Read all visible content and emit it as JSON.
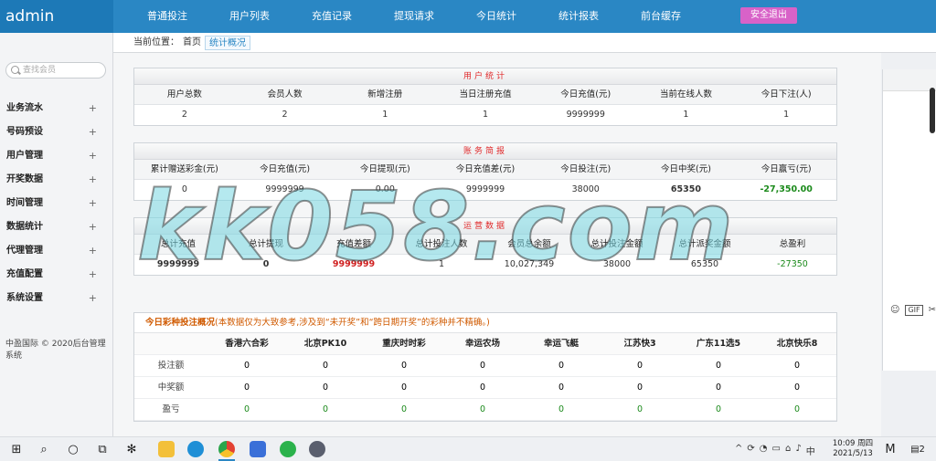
{
  "header": {
    "logo": "admin",
    "nav": [
      "普通投注",
      "用户列表",
      "充值记录",
      "提现请求",
      "今日统计",
      "统计报表",
      "前台缓存"
    ],
    "logout": "安全退出"
  },
  "breadcrumb": {
    "label": "当前位置：",
    "home": "首页",
    "current": "统计概况"
  },
  "sidebar": {
    "search_placeholder": "查找会员",
    "items": [
      {
        "label": "业务流水"
      },
      {
        "label": "号码预设"
      },
      {
        "label": "用户管理"
      },
      {
        "label": "开奖数据"
      },
      {
        "label": "时间管理"
      },
      {
        "label": "数据统计"
      },
      {
        "label": "代理管理"
      },
      {
        "label": "充值配置"
      },
      {
        "label": "系统设置"
      }
    ],
    "plus": "+",
    "copyright": "中盈国际 © 2020后台管理系统"
  },
  "user_stats": {
    "title": "用户统计",
    "headers": [
      "用户总数",
      "会员人数",
      "新增注册",
      "当日注册充值",
      "今日充值(元)",
      "当前在线人数",
      "今日下注(人)"
    ],
    "values": [
      "2",
      "2",
      "1",
      "1",
      "9999999",
      "1",
      "1"
    ]
  },
  "finance": {
    "title": "账务简报",
    "headers": [
      "累计赠送彩金(元)",
      "今日充值(元)",
      "今日提现(元)",
      "今日充值差(元)",
      "今日投注(元)",
      "今日中奖(元)",
      "今日赢亏(元)"
    ],
    "values": [
      "0",
      "9999999",
      "0.00",
      "9999999",
      "38000",
      "65350",
      "-27,350.00"
    ]
  },
  "operations": {
    "title": "运营数据",
    "headers": [
      "总计充值",
      "总计提现",
      "充值差额",
      "总计投注人数",
      "会员总余额",
      "总计投注金额",
      "总计派奖金额",
      "总盈利"
    ],
    "values": [
      "9999999",
      "0",
      "9999999",
      "1",
      "10,027,349",
      "38000",
      "65350",
      "-27350"
    ]
  },
  "lottery": {
    "title": "今日彩种投注概况",
    "note": "(本数据仅为大致参考,涉及到“未开奖”和“跨日期开奖”的彩种并不精确。)",
    "columns": [
      "香港六合彩",
      "北京PK10",
      "重庆时时彩",
      "幸运农场",
      "幸运飞艇",
      "江苏快3",
      "广东11选5",
      "北京快乐8"
    ],
    "rows": [
      {
        "label": "投注额",
        "values": [
          "0",
          "0",
          "0",
          "0",
          "0",
          "0",
          "0",
          "0"
        ]
      },
      {
        "label": "中奖额",
        "values": [
          "0",
          "0",
          "0",
          "0",
          "0",
          "0",
          "0",
          "0"
        ]
      },
      {
        "label": "盈亏",
        "values": [
          "0",
          "0",
          "0",
          "0",
          "0",
          "0",
          "0",
          "0"
        ]
      }
    ]
  },
  "watermark": "kk058.com",
  "right_widget": {
    "gif": "GIF"
  },
  "taskbar": {
    "time": "10:09 周四",
    "date": "2021/5/13",
    "ime": "中",
    "notifications": "2"
  },
  "colors": {
    "header_bg": "#2a87c4",
    "logout_bg": "#d862c8",
    "title_red": "#e0292a",
    "profit_green": "#1b8a1b",
    "diff_red": "#d02020"
  }
}
